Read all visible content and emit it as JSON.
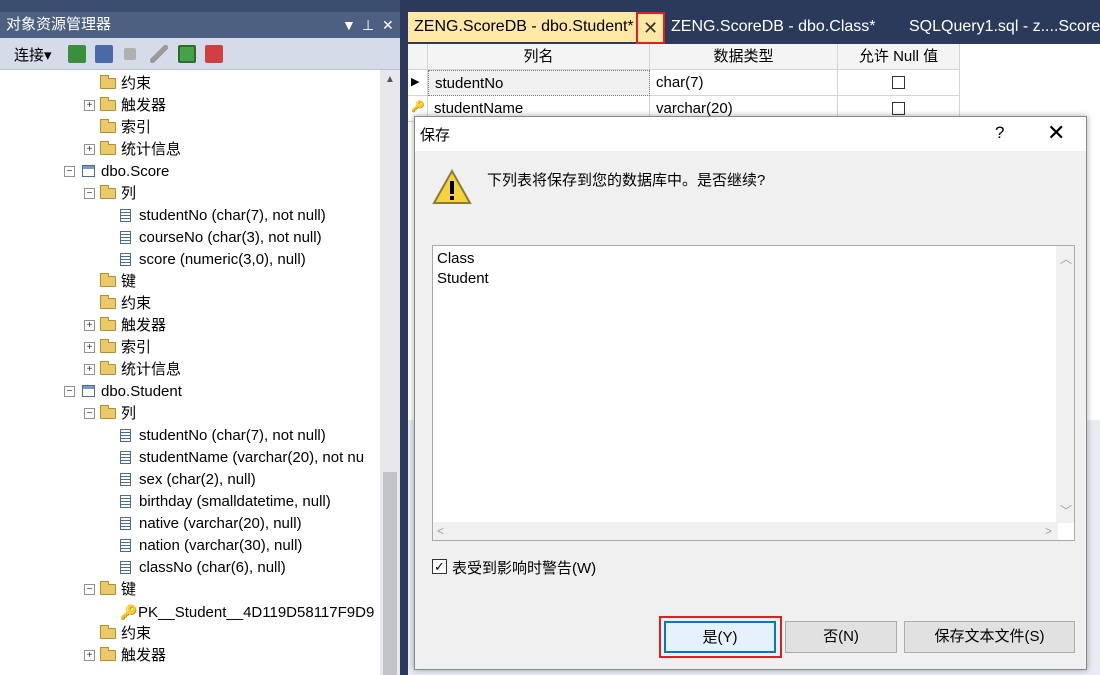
{
  "object_explorer": {
    "title": "对象资源管理器",
    "pin": "▾ ╠ ✕",
    "connect_label": "连接▾"
  },
  "tree": [
    {
      "indent": 1,
      "kind": "folder",
      "expander": "",
      "label": "约束"
    },
    {
      "indent": 1,
      "kind": "folder",
      "expander": "+",
      "label": "触发器"
    },
    {
      "indent": 1,
      "kind": "folder",
      "expander": "",
      "label": "索引"
    },
    {
      "indent": 1,
      "kind": "folder",
      "expander": "+",
      "label": "统计信息"
    },
    {
      "indent": 0,
      "kind": "table",
      "expander": "−",
      "label": "dbo.Score"
    },
    {
      "indent": 1,
      "kind": "folder",
      "expander": "−",
      "label": "列"
    },
    {
      "indent": 2,
      "kind": "column",
      "expander": "",
      "label": "studentNo (char(7), not null)"
    },
    {
      "indent": 2,
      "kind": "column",
      "expander": "",
      "label": "courseNo (char(3), not null)"
    },
    {
      "indent": 2,
      "kind": "column",
      "expander": "",
      "label": "score (numeric(3,0), null)"
    },
    {
      "indent": 1,
      "kind": "folder",
      "expander": "",
      "label": "键"
    },
    {
      "indent": 1,
      "kind": "folder",
      "expander": "",
      "label": "约束"
    },
    {
      "indent": 1,
      "kind": "folder",
      "expander": "+",
      "label": "触发器"
    },
    {
      "indent": 1,
      "kind": "folder",
      "expander": "+",
      "label": "索引"
    },
    {
      "indent": 1,
      "kind": "folder",
      "expander": "+",
      "label": "统计信息"
    },
    {
      "indent": 0,
      "kind": "table",
      "expander": "−",
      "label": "dbo.Student"
    },
    {
      "indent": 1,
      "kind": "folder",
      "expander": "−",
      "label": "列"
    },
    {
      "indent": 2,
      "kind": "column",
      "expander": "",
      "label": "studentNo (char(7), not null)"
    },
    {
      "indent": 2,
      "kind": "column",
      "expander": "",
      "label": "studentName (varchar(20), not nu"
    },
    {
      "indent": 2,
      "kind": "column",
      "expander": "",
      "label": "sex (char(2), null)"
    },
    {
      "indent": 2,
      "kind": "column",
      "expander": "",
      "label": "birthday (smalldatetime, null)"
    },
    {
      "indent": 2,
      "kind": "column",
      "expander": "",
      "label": "native (varchar(20), null)"
    },
    {
      "indent": 2,
      "kind": "column",
      "expander": "",
      "label": "nation (varchar(30), null)"
    },
    {
      "indent": 2,
      "kind": "column",
      "expander": "",
      "label": "classNo (char(6), null)"
    },
    {
      "indent": 1,
      "kind": "folder",
      "expander": "−",
      "label": "键"
    },
    {
      "indent": 2,
      "kind": "key",
      "expander": "",
      "label": "PK__Student__4D119D58117F9D9"
    },
    {
      "indent": 1,
      "kind": "folder",
      "expander": "",
      "label": "约束"
    },
    {
      "indent": 1,
      "kind": "folder",
      "expander": "+",
      "label": "触发器"
    }
  ],
  "tabs": [
    {
      "label": "ZENG.ScoreDB - dbo.Student*",
      "active": true
    },
    {
      "label": "ZENG.ScoreDB - dbo.Class*",
      "active": false
    },
    {
      "label": "SQLQuery1.sql - z....ScoreDB",
      "active": false
    }
  ],
  "tab_close_glyph": "✕",
  "table_designer": {
    "headers": [
      "列名",
      "数据类型",
      "允许 Null 值"
    ],
    "rows": [
      {
        "name": "studentNo",
        "type": "char(7)",
        "allow_null": false,
        "primary_key": true
      },
      {
        "name": "studentName",
        "type": "varchar(20)",
        "allow_null": false,
        "primary_key": false
      }
    ]
  },
  "dialog": {
    "title": "保存",
    "help": "?",
    "close": "✕",
    "message": "下列表将保存到您的数据库中。是否继续?",
    "tables": [
      "Class",
      "Student"
    ],
    "warn_checkbox_label": "表受到影响时警告(W)",
    "warn_checked": true,
    "buttons": {
      "yes": "是(Y)",
      "no": "否(N)",
      "save_text": "保存文本文件(S)"
    }
  },
  "colors": {
    "highlight_red": "#e02020",
    "active_tab": "#ffe8a6",
    "panel_title": "#4d6082",
    "focus_blue": "#0078d7"
  }
}
